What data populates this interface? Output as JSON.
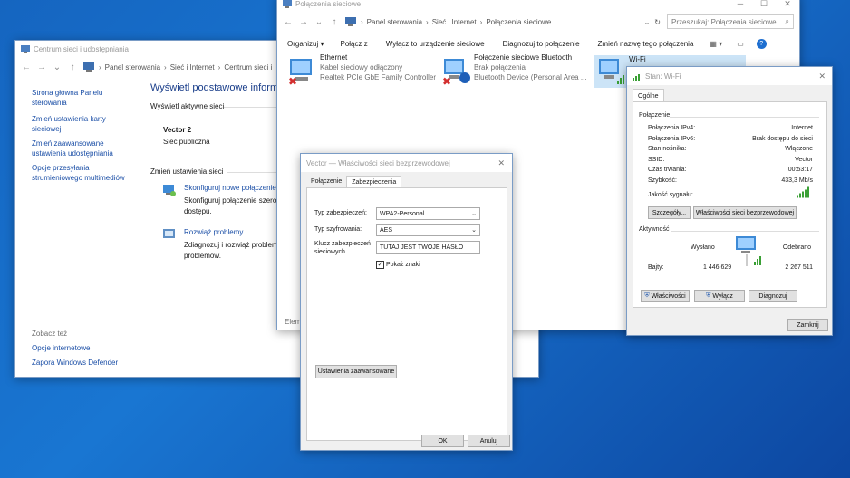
{
  "network_center": {
    "title": "Centrum sieci i udostępniania",
    "breadcrumb": [
      "Panel sterowania",
      "Sieć i Internet",
      "Centrum sieci i"
    ],
    "sidebar": {
      "items": [
        "Strona główna Panelu sterowania",
        "Zmień ustawienia karty sieciowej",
        "Zmień zaawansowane ustawienia udostępniania",
        "Opcje przesyłania strumieniowego multimediów"
      ],
      "see_also_label": "Zobacz też",
      "see_also": [
        "Opcje internetowe",
        "Zapora Windows Defender"
      ]
    },
    "heading": "Wyświetl podstawowe inform",
    "active_networks_label": "Wyświetl aktywne sieci",
    "network_name": "Vector 2",
    "network_type": "Sieć publiczna",
    "change_settings_label": "Zmień ustawienia sieci",
    "tasks": [
      {
        "title": "Skonfiguruj nowe połączenie",
        "desc": "Skonfiguruj połączenie szero dostępu."
      },
      {
        "title": "Rozwiąż problemy",
        "desc": "Zdiagnozuj i rozwiąż problem problemów."
      }
    ]
  },
  "connections": {
    "title": "Połączenia sieciowe",
    "breadcrumb": [
      "Panel sterowania",
      "Sieć i Internet",
      "Połączenia sieciowe"
    ],
    "search_placeholder": "Przeszukaj: Połączenia sieciowe",
    "toolbar": [
      "Organizuj ▾",
      "Połącz z",
      "Wyłącz to urządzenie sieciowe",
      "Diagnozuj to połączenie",
      "Zmień nazwę tego połączenia"
    ],
    "adapters": [
      {
        "name": "Ethernet",
        "status": "Kabel sieciowy odłączony",
        "device": "Realtek PCIe GbE Family Controller"
      },
      {
        "name": "Połączenie sieciowe Bluetooth",
        "status": "Brak połączenia",
        "device": "Bluetooth Device (Personal Area ..."
      },
      {
        "name": "Wi-Fi",
        "status": "",
        "device": ""
      }
    ],
    "status_text": "Elem"
  },
  "props": {
    "title": "Vector — Właściwości sieci bezprzewodowej",
    "tabs": [
      "Połączenie",
      "Zabezpieczenia"
    ],
    "security_type_label": "Typ zabezpieczeń:",
    "security_type_value": "WPA2-Personal",
    "encryption_label": "Typ szyfrowania:",
    "encryption_value": "AES",
    "key_label": "Klucz zabezpieczeń sieciowych",
    "key_value": "TUTAJ JEST TWOJE HASŁO",
    "show_chars_label": "Pokaż znaki",
    "advanced_button": "Ustawienia zaawansowane",
    "ok_button": "OK",
    "cancel_button": "Anuluj"
  },
  "wifi_status": {
    "title": "Stan: Wi-Fi",
    "tab": "Ogólne",
    "connection_group": "Połączenie",
    "rows": [
      {
        "label": "Połączenia IPv4:",
        "value": "Internet"
      },
      {
        "label": "Połączenia IPv6:",
        "value": "Brak dostępu do sieci"
      },
      {
        "label": "Stan nośnika:",
        "value": "Włączone"
      },
      {
        "label": "SSID:",
        "value": "Vector"
      },
      {
        "label": "Czas trwania:",
        "value": "00:53:17"
      },
      {
        "label": "Szybkość:",
        "value": "433,3 Mb/s"
      }
    ],
    "signal_label": "Jakość sygnału:",
    "details_button": "Szczegóły...",
    "wireless_props_button": "Właściwości sieci bezprzewodowej",
    "activity_group": "Aktywność",
    "sent_label": "Wysłano",
    "received_label": "Odebrano",
    "bytes_label": "Bajty:",
    "bytes_sent": "1 446 629",
    "bytes_received": "2 267 511",
    "properties_button": "Właściwości",
    "disable_button": "Wyłącz",
    "diagnose_button": "Diagnozuj",
    "close_button": "Zamknij"
  }
}
